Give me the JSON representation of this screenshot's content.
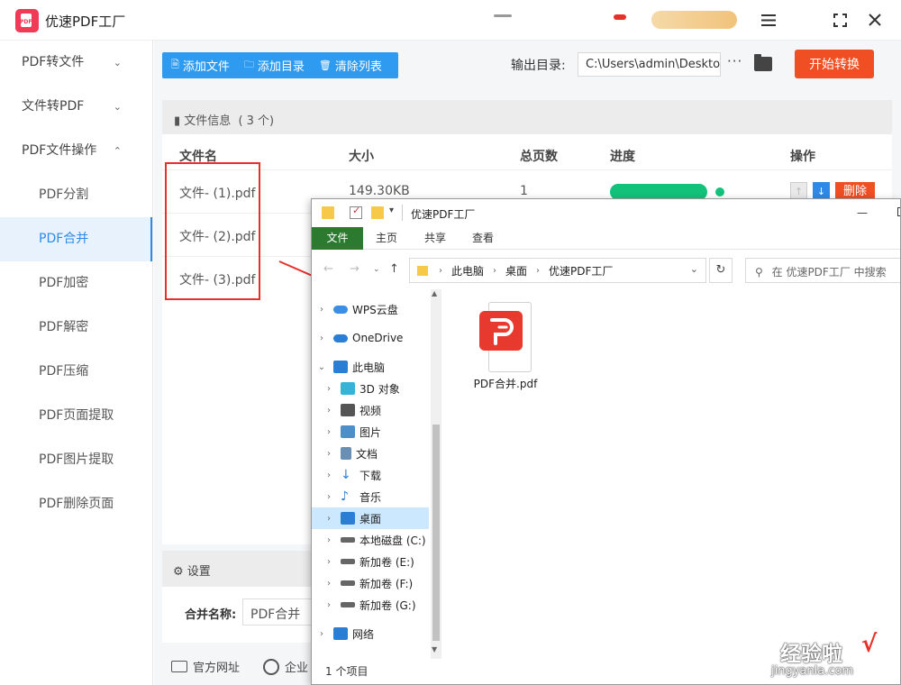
{
  "app": {
    "title": "优速PDF工厂"
  },
  "sidebar": {
    "groups": [
      {
        "label": "PDF转文件",
        "chevron": "chevron-down-icon"
      },
      {
        "label": "文件转PDF",
        "chevron": "chevron-down-icon"
      },
      {
        "label": "PDF文件操作",
        "chevron": "chevron-up-icon"
      }
    ],
    "items": [
      "PDF分割",
      "PDF合并",
      "PDF加密",
      "PDF解密",
      "PDF压缩",
      "PDF页面提取",
      "PDF图片提取",
      "PDF删除页面"
    ],
    "active_item": "PDF合并"
  },
  "toolbar": {
    "add_file": "添加文件",
    "add_dir": "添加目录",
    "clear_list": "清除列表"
  },
  "output": {
    "label": "输出目录:",
    "path": "C:\\Users\\admin\\Deskto",
    "more": "···",
    "start_button": "开始转换"
  },
  "file_info": {
    "label": "文件信息",
    "count": "( 3 个)"
  },
  "table": {
    "headers": [
      "文件名",
      "大小",
      "总页数",
      "进度",
      "操作"
    ],
    "rows": [
      {
        "name": "文件- (1).pdf",
        "size": "149.30KB",
        "pages": "1",
        "progress": 1.0,
        "delete": "删除"
      },
      {
        "name": "文件- (2).pdf"
      },
      {
        "name": "文件- (3).pdf"
      }
    ]
  },
  "settings": {
    "label": "设置",
    "merge_name_label": "合并名称:",
    "merge_name_value": "PDF合并"
  },
  "footer": {
    "official_site": "官方网址",
    "enterprise": "企业"
  },
  "explorer": {
    "title": "优速PDF工厂",
    "ribbon_tabs": [
      "文件",
      "主页",
      "共享",
      "查看"
    ],
    "breadcrumb": [
      "此电脑",
      "桌面",
      "优速PDF工厂"
    ],
    "search_placeholder": "在 优速PDF工厂 中搜索",
    "nav_items": [
      {
        "label": "WPS云盘",
        "icon": "cloud-icon",
        "color": "#3a8ee6"
      },
      {
        "label": "OneDrive",
        "icon": "onedrive-icon",
        "color": "#2a7fd4"
      },
      {
        "label": "此电脑",
        "icon": "computer-icon",
        "color": "#2a7fd4"
      },
      {
        "label": "3D 对象",
        "icon": "cube-icon",
        "color": "#36b3d6"
      },
      {
        "label": "视频",
        "icon": "video-icon",
        "color": "#555"
      },
      {
        "label": "图片",
        "icon": "picture-icon",
        "color": "#4d8fc9"
      },
      {
        "label": "文档",
        "icon": "document-icon",
        "color": "#6a8fb5"
      },
      {
        "label": "下载",
        "icon": "download-icon",
        "color": "#2a7fd4"
      },
      {
        "label": "音乐",
        "icon": "music-icon",
        "color": "#2a7fd4"
      },
      {
        "label": "桌面",
        "icon": "desktop-icon",
        "color": "#2a7fd4"
      },
      {
        "label": "本地磁盘 (C:)",
        "icon": "disk-icon",
        "color": "#666"
      },
      {
        "label": "新加卷 (E:)",
        "icon": "drive-icon",
        "color": "#666"
      },
      {
        "label": "新加卷 (F:)",
        "icon": "drive-icon",
        "color": "#666"
      },
      {
        "label": "新加卷 (G:)",
        "icon": "drive-icon",
        "color": "#666"
      },
      {
        "label": "网络",
        "icon": "network-icon",
        "color": "#2a7fd4"
      }
    ],
    "selected_item": "桌面",
    "file": {
      "name": "PDF合并.pdf",
      "icon": "wps-pdf-icon"
    },
    "status": "1 个项目"
  },
  "watermark": {
    "text": "经验啦",
    "check": "√",
    "url": "jingyanla.com"
  },
  "colors": {
    "accent_blue": "#2e9af0",
    "danger": "#f04e23",
    "success": "#13c27a",
    "highlight": "#e8302a"
  }
}
